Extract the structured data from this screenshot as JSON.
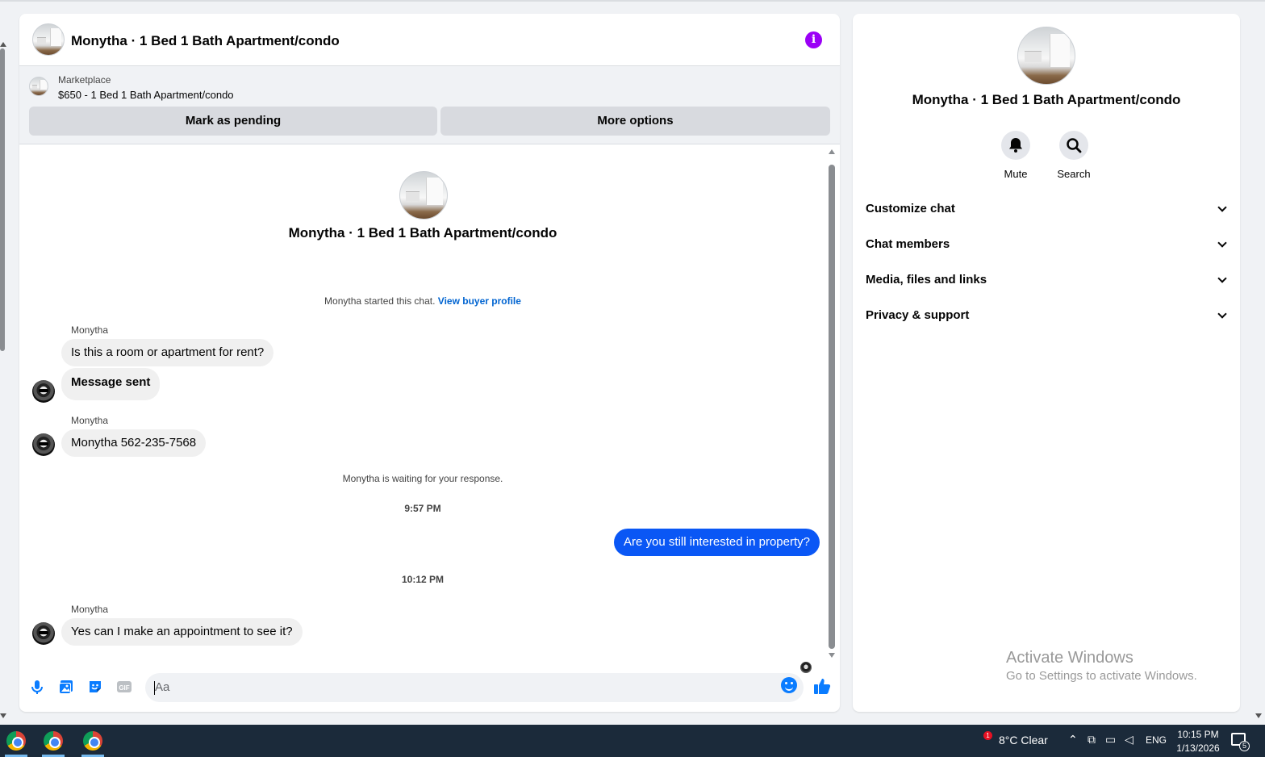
{
  "chat": {
    "header_title": "Monytha · 1 Bed 1 Bath Apartment/condo",
    "marketplace_label": "Marketplace",
    "listing": "$650 - 1 Bed 1 Bath Apartment/condo",
    "mark_pending": "Mark as pending",
    "more_options": "More options",
    "center_name": "Monytha · 1 Bed 1 Bath Apartment/condo",
    "started_text": "Monytha started this chat.",
    "buyer_profile_link": "View buyer profile",
    "messages": [
      {
        "sender": "Monytha",
        "text": "Is this a room or apartment for rent?"
      },
      {
        "text": "Message sent"
      },
      {
        "sender": "Monytha",
        "text": "Monytha 562-235-7568"
      },
      {
        "system": "Monytha is waiting for your response."
      },
      {
        "time": "9:57 PM"
      },
      {
        "mine": true,
        "text": "Are you still interested in property?"
      },
      {
        "time": "10:12 PM"
      },
      {
        "sender": "Monytha",
        "text": "Yes can I make an appointment to see it?"
      }
    ],
    "composer_placeholder": "Aa",
    "accent": "#0a7cff",
    "own_bubble_color": "#0a57f5",
    "info_color": "#9b00f6"
  },
  "side": {
    "name": "Monytha · 1 Bed 1 Bath Apartment/condo",
    "mute": "Mute",
    "search": "Search",
    "sections": [
      "Customize chat",
      "Chat members",
      "Media, files and links",
      "Privacy & support"
    ],
    "activate_title": "Activate Windows",
    "activate_sub": "Go to Settings to activate Windows."
  },
  "taskbar": {
    "weather_badge": "1",
    "weather": "8°C  Clear",
    "language": "ENG",
    "time": "10:15 PM",
    "date": "1/13/2026",
    "notification_count": "5"
  }
}
